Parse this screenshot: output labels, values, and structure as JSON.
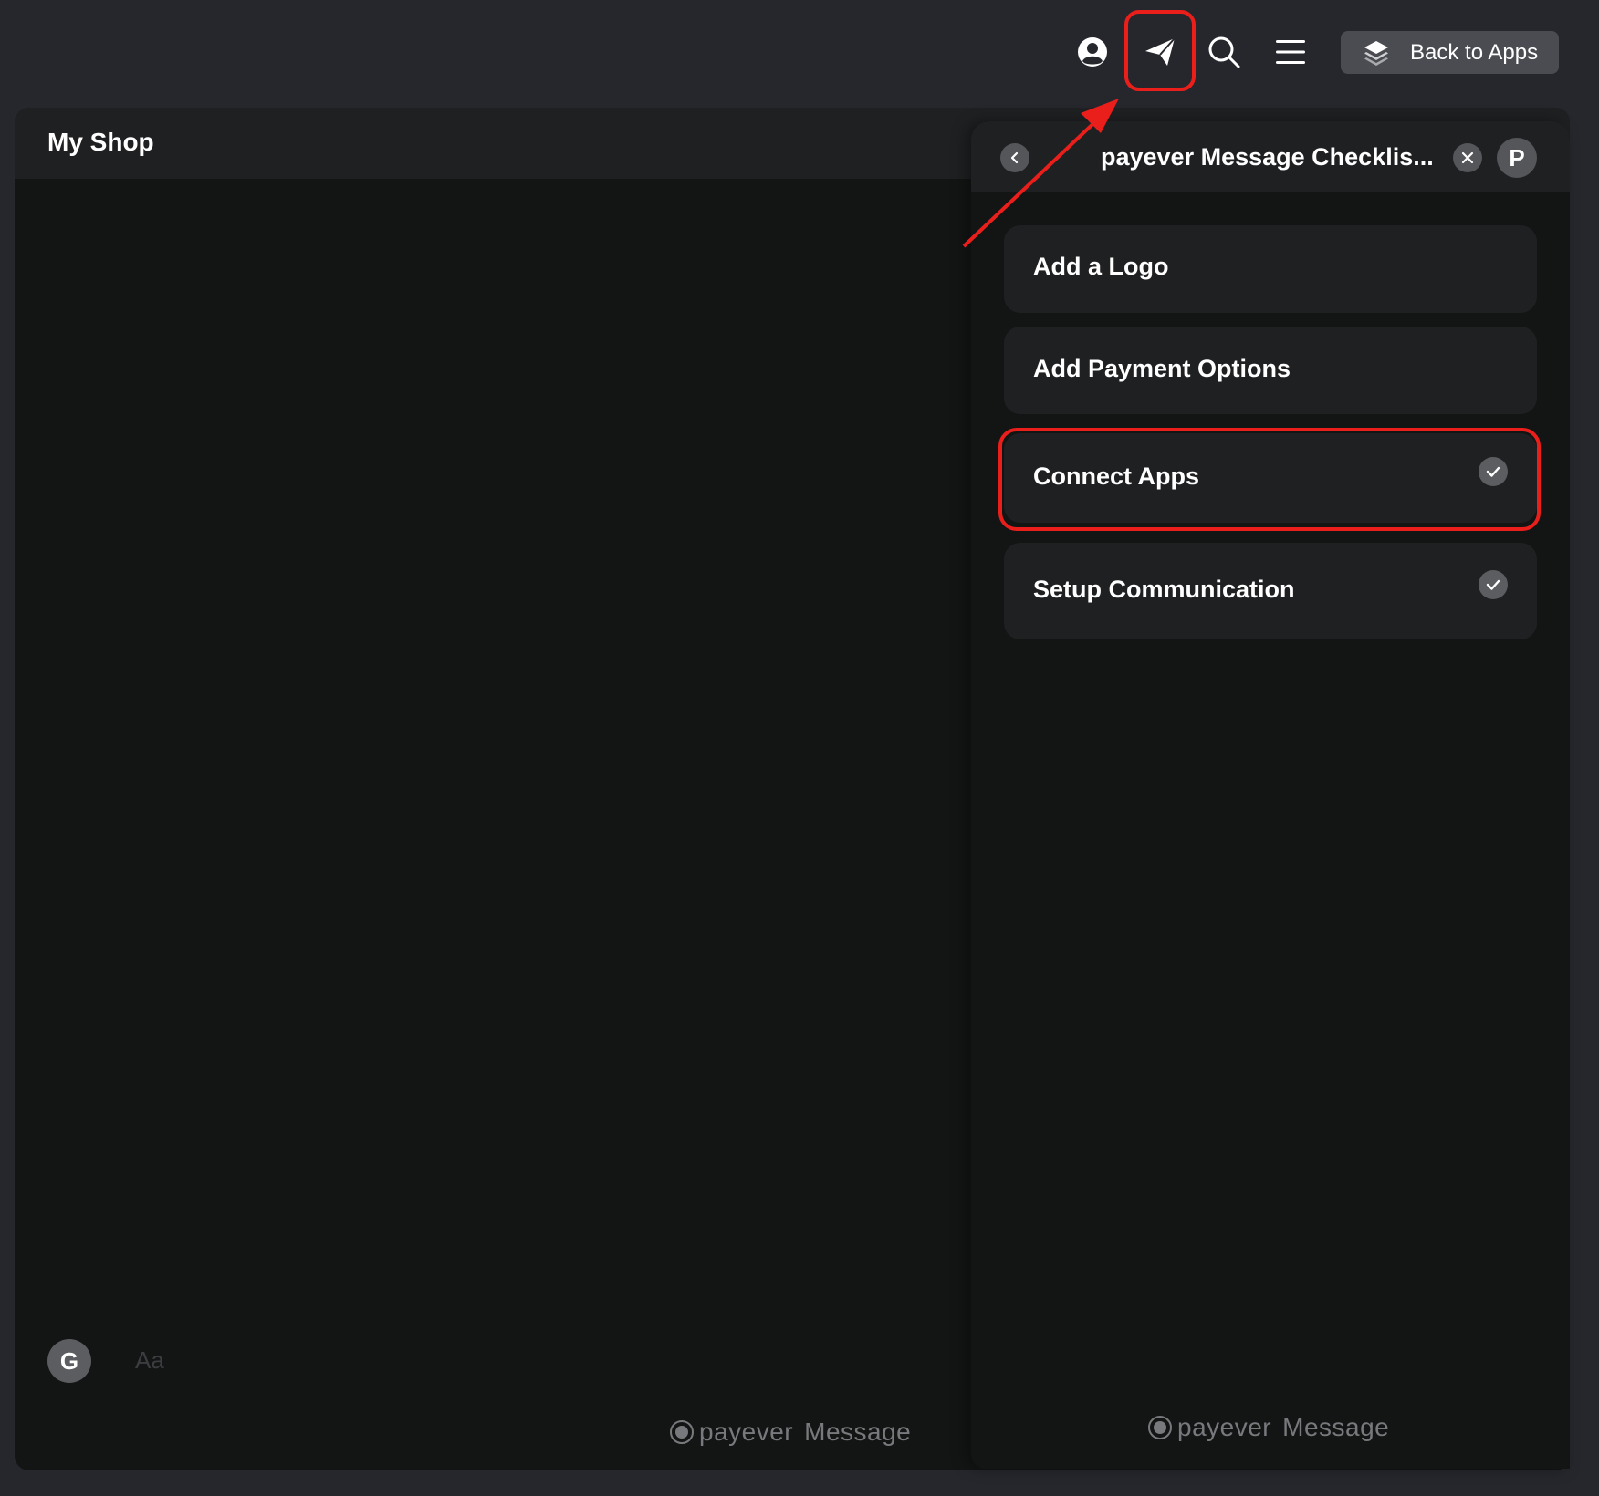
{
  "topbar": {
    "icons": [
      "user-circle-icon",
      "send-icon",
      "search-icon",
      "menu-icon"
    ],
    "back_button": {
      "label": "Back to Apps",
      "icon": "layers-icon"
    }
  },
  "app": {
    "title": "My Shop",
    "composer": {
      "avatar_letter": "G",
      "placeholder": "Aa"
    },
    "brand": {
      "name": "payever",
      "product": "Message"
    }
  },
  "panel": {
    "title": "payever Message Checklis...",
    "avatar_letter": "P",
    "tasks": [
      {
        "label": "Add a Logo",
        "done": false
      },
      {
        "label": "Add Payment Options",
        "done": false
      },
      {
        "label": "Connect Apps",
        "done": true
      },
      {
        "label": "Setup Communication",
        "done": true
      }
    ],
    "brand": {
      "name": "payever",
      "product": "Message"
    }
  },
  "annotations": {
    "highlight_color": "#ea1f1b"
  },
  "colors": {
    "background": "#25272d",
    "surface": "#131515",
    "card": "#1f2022",
    "button": "#4a4c51"
  }
}
